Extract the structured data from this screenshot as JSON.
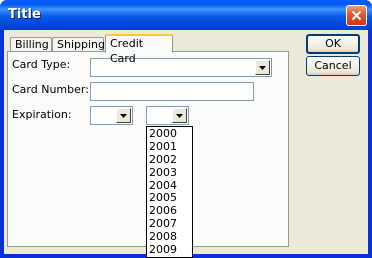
{
  "window": {
    "title": "Title"
  },
  "tabs": [
    {
      "label": "Billing",
      "active": false
    },
    {
      "label": "Shipping",
      "active": false
    },
    {
      "label": "Credit Card",
      "active": true
    }
  ],
  "form": {
    "card_type_label": "Card Type:",
    "card_type_value": "",
    "card_number_label": "Card Number:",
    "card_number_value": "",
    "expiration_label": "Expiration:",
    "expiration_month_value": "",
    "expiration_year_value": ""
  },
  "year_options": [
    "2000",
    "2001",
    "2002",
    "2003",
    "2004",
    "2005",
    "2006",
    "2007",
    "2008",
    "2009"
  ],
  "buttons": {
    "ok": "OK",
    "cancel": "Cancel"
  },
  "colors": {
    "titlebar": "#0058ee",
    "close_button": "#e35a34",
    "dialog_face": "#ece9d8",
    "tab_highlight": "#ffc83c"
  },
  "icons": {
    "close": "close-icon",
    "dropdown": "chevron-down-icon"
  }
}
